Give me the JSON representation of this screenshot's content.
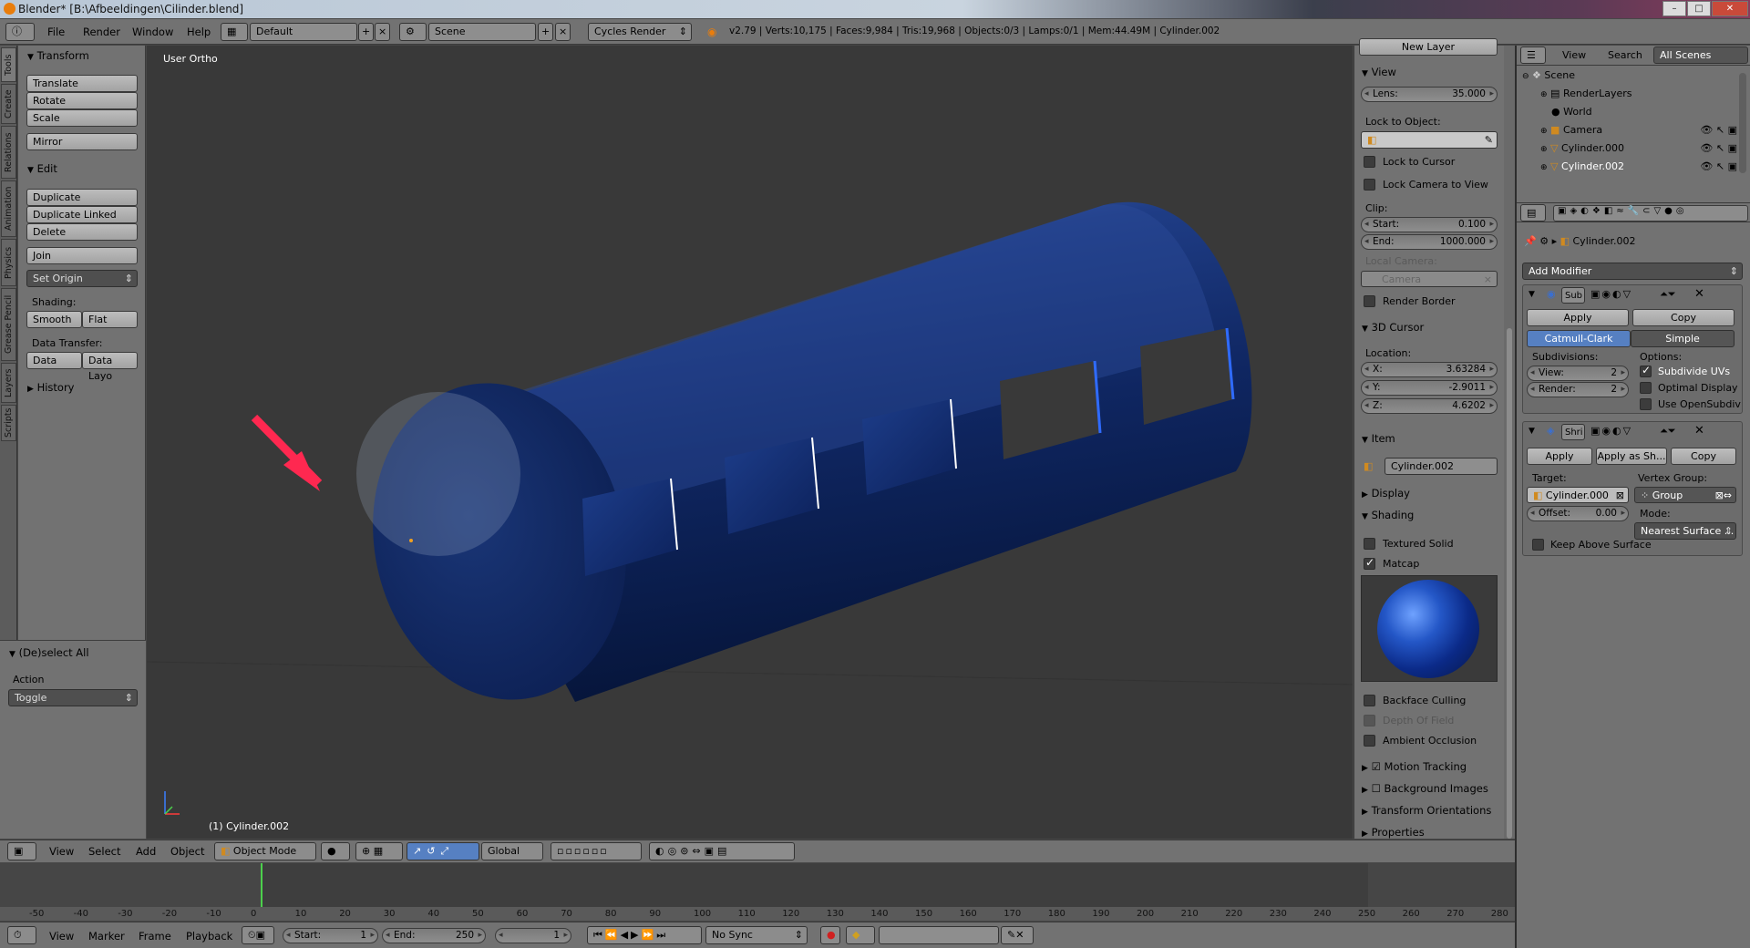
{
  "title_bar": {
    "title": "Blender* [B:\\Afbeeldingen\\Cilinder.blend]"
  },
  "top_menu": {
    "items": [
      "File",
      "Render",
      "Window",
      "Help"
    ],
    "screen_layout": "Default",
    "scene": "Scene",
    "render_engine": "Cycles Render",
    "stats": "v2.79 | Verts:10,175 | Faces:9,984 | Tris:19,968 | Objects:0/3 | Lamps:0/1 | Mem:44.49M | Cylinder.002"
  },
  "left_tabs": [
    "Tools",
    "Create",
    "Relations",
    "Animation",
    "Physics",
    "Grease Pencil",
    "Layers",
    "Scripts"
  ],
  "tool_shelf": {
    "transform": {
      "header": "Transform",
      "buttons": [
        "Translate",
        "Rotate",
        "Scale",
        "Mirror"
      ]
    },
    "edit": {
      "header": "Edit",
      "buttons": [
        "Duplicate",
        "Duplicate Linked",
        "Delete",
        "Join"
      ],
      "set_origin": "Set Origin"
    },
    "shading": {
      "label": "Shading:",
      "smooth": "Smooth",
      "flat": "Flat"
    },
    "data_transfer": {
      "label": "Data Transfer:",
      "data": "Data",
      "data_layout": "Data Layo"
    },
    "history": "History",
    "operator": {
      "header": "(De)select All",
      "action_label": "Action",
      "action_value": "Toggle"
    }
  },
  "viewport": {
    "view_label": "User Ortho",
    "object_label": "(1) Cylinder.002"
  },
  "n_panel": {
    "new_layer": "New Layer",
    "view": {
      "header": "View",
      "lens_label": "Lens:",
      "lens_value": "35.000",
      "lock_to_object": "Lock to Object:",
      "lock_to_cursor": "Lock to Cursor",
      "lock_camera": "Lock Camera to View",
      "clip": "Clip:",
      "start_label": "Start:",
      "start_value": "0.100",
      "end_label": "End:",
      "end_value": "1000.000",
      "local_camera": "Local Camera:",
      "camera": "Camera",
      "render_border": "Render Border"
    },
    "cursor": {
      "header": "3D Cursor",
      "location": "Location:",
      "x_label": "X:",
      "x_value": "3.63284",
      "y_label": "Y:",
      "y_value": "-2.9011",
      "z_label": "Z:",
      "z_value": "4.6202"
    },
    "item": {
      "header": "Item",
      "name": "Cylinder.002"
    },
    "display": "Display",
    "shading": {
      "header": "Shading",
      "textured_solid": "Textured Solid",
      "matcap": "Matcap",
      "backface_culling": "Backface Culling",
      "depth_of_field": "Depth Of Field",
      "ambient_occlusion": "Ambient Occlusion"
    },
    "motion_tracking": "Motion Tracking",
    "background_images": "Background Images",
    "transform_orientations": "Transform Orientations",
    "properties": "Properties"
  },
  "outliner": {
    "view": "View",
    "search": "Search",
    "filter": "All Scenes",
    "items": [
      {
        "label": "Scene"
      },
      {
        "label": "RenderLayers"
      },
      {
        "label": "World"
      },
      {
        "label": "Camera"
      },
      {
        "label": "Cylinder.000"
      },
      {
        "label": "Cylinder.002"
      }
    ]
  },
  "properties": {
    "object": "Cylinder.002",
    "add_modifier": "Add Modifier",
    "subsurf": {
      "name": "Sub",
      "apply": "Apply",
      "copy": "Copy",
      "catmull": "Catmull-Clark",
      "simple": "Simple",
      "subdivisions": "Subdivisions:",
      "options": "Options:",
      "view_label": "View:",
      "view_value": "2",
      "render_label": "Render:",
      "render_value": "2",
      "subdivide_uvs": "Subdivide UVs",
      "optimal_display": "Optimal Display",
      "use_opensubdiv": "Use OpenSubdiv"
    },
    "shrinkwrap": {
      "name": "Shri",
      "apply": "Apply",
      "apply_shape": "Apply as Sh...",
      "copy": "Copy",
      "target_label": "Target:",
      "target": "Cylinder.000",
      "vertex_group_label": "Vertex Group:",
      "group": "Group",
      "offset_label": "Offset:",
      "offset_value": "0.00",
      "mode_label": "Mode:",
      "mode": "Nearest Surface ...",
      "keep_above": "Keep Above Surface"
    }
  },
  "viewport_header": {
    "view": "View",
    "select": "Select",
    "add": "Add",
    "object": "Object",
    "mode": "Object Mode",
    "orientation": "Global"
  },
  "timeline": {
    "ticks": [
      "-50",
      "-40",
      "-30",
      "-20",
      "-10",
      "0",
      "10",
      "20",
      "30",
      "40",
      "50",
      "60",
      "70",
      "80",
      "90",
      "100",
      "110",
      "120",
      "130",
      "140",
      "150",
      "160",
      "170",
      "180",
      "190",
      "200",
      "210",
      "220",
      "230",
      "240",
      "250",
      "260",
      "270",
      "280"
    ],
    "current_frame": "1",
    "start_label": "Start:",
    "start": "1",
    "end_label": "End:",
    "end": "250",
    "sync": "No Sync",
    "menus": [
      "View",
      "Marker",
      "Frame",
      "Playback"
    ]
  }
}
